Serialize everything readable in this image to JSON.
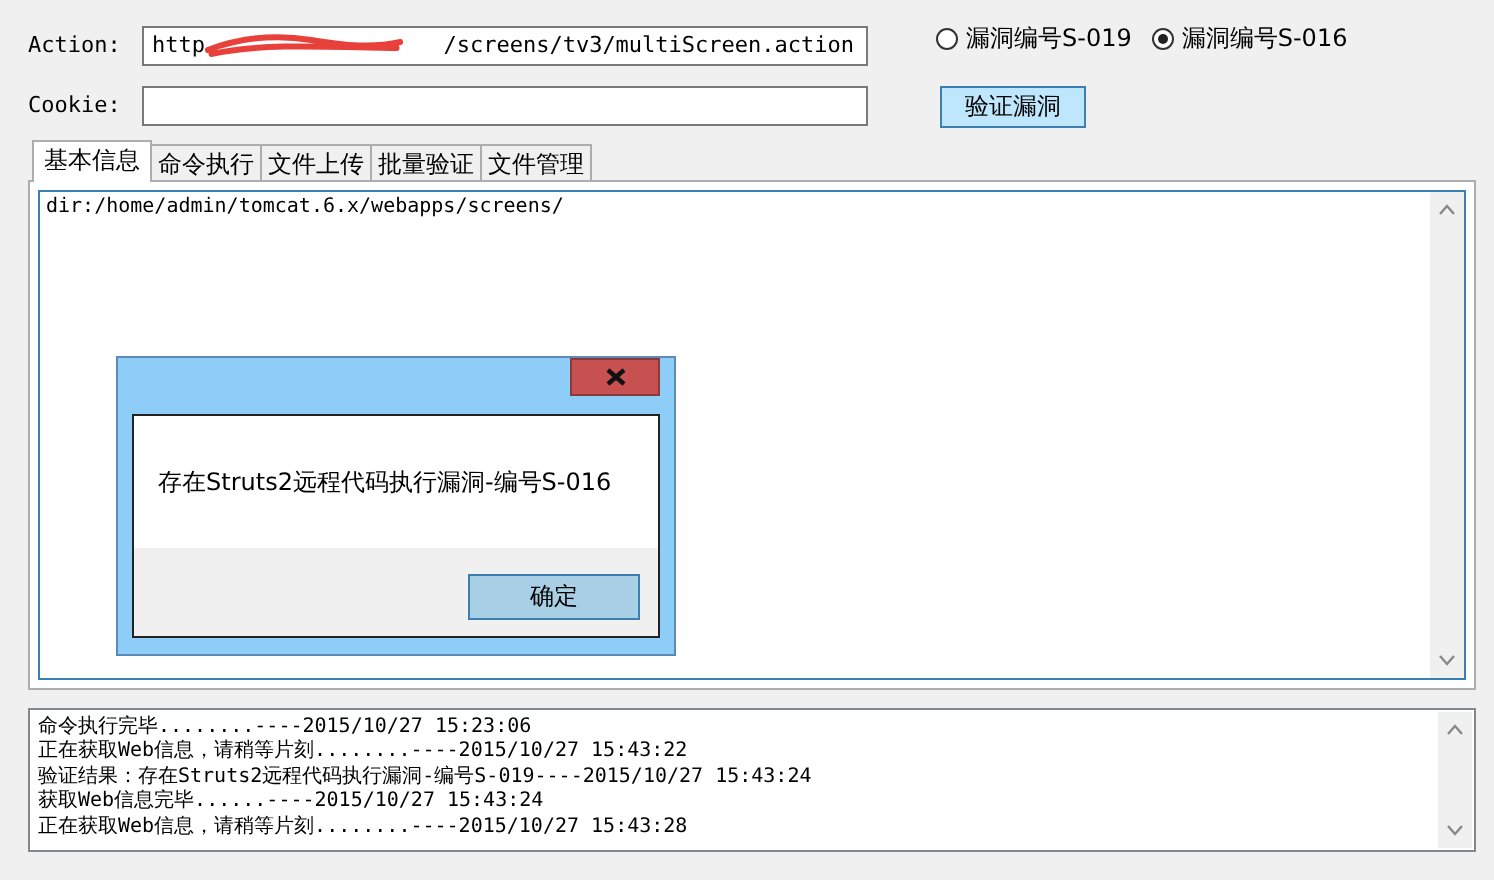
{
  "form": {
    "action_label": "Action:",
    "action_value_start": "http",
    "action_value_end": "/screens/tv3/multiScreen.action",
    "cookie_label": "Cookie:"
  },
  "options": [
    {
      "label": "漏洞编号S-019",
      "selected": false
    },
    {
      "label": "漏洞编号S-016",
      "selected": true
    }
  ],
  "verify_button": "验证漏洞",
  "tabs": [
    {
      "label": "基本信息",
      "selected": true
    },
    {
      "label": "命令执行",
      "selected": false
    },
    {
      "label": "文件上传",
      "selected": false
    },
    {
      "label": "批量验证",
      "selected": false
    },
    {
      "label": "文件管理",
      "selected": false
    }
  ],
  "panel": {
    "text": "dir:/home/admin/tomcat.6.x/webapps/screens/"
  },
  "dialog": {
    "message": "存在Struts2远程代码执行漏洞-编号S-016",
    "ok_button": "确定"
  },
  "log": [
    "命令执行完毕........----2015/10/27 15:23:06",
    "正在获取Web信息，请稍等片刻........----2015/10/27 15:43:22",
    "验证结果：存在Struts2远程代码执行漏洞-编号S-019----2015/10/27 15:43:24",
    "获取Web信息完毕......----2015/10/27 15:43:24",
    "正在获取Web信息，请稍等片刻........----2015/10/27 15:43:28"
  ]
}
